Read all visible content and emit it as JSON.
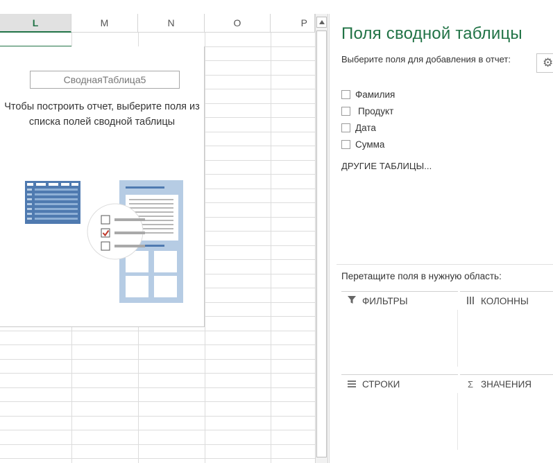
{
  "sheet": {
    "columns": [
      "L",
      "M",
      "N",
      "O",
      "P"
    ],
    "selected_column": "L"
  },
  "pivot": {
    "name": "СводнаяТаблица5",
    "instructions": "Чтобы построить отчет, выберите поля из списка полей сводной таблицы"
  },
  "pane": {
    "title": "Поля сводной таблицы",
    "subtitle": "Выберите поля для добавления в отчет:",
    "settings_icon": "gear-icon",
    "fields": [
      {
        "label": "Фамилия",
        "checked": false
      },
      {
        "label": "Продукт",
        "checked": false
      },
      {
        "label": "Дата",
        "checked": false
      },
      {
        "label": "Сумма",
        "checked": false
      }
    ],
    "other_tables": "ДРУГИЕ ТАБЛИЦЫ...",
    "drag_hint": "Перетащите поля в нужную область:",
    "areas": {
      "filters": "ФИЛЬТРЫ",
      "columns": "КОЛОННЫ",
      "rows": "СТРОКИ",
      "values": "ЗНАЧЕНИЯ"
    }
  },
  "colors": {
    "accent": "#217346",
    "illustration_blue": "#4f7ab0",
    "illustration_light": "#b6cce4",
    "check_red": "#c0392b"
  }
}
